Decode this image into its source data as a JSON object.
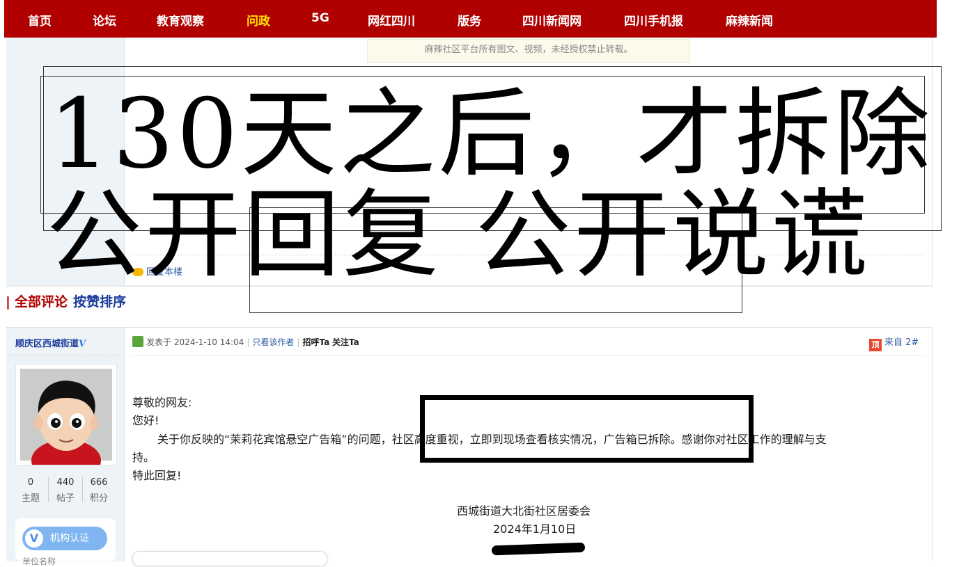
{
  "nav": {
    "items": [
      {
        "label": "首页"
      },
      {
        "label": "论坛"
      },
      {
        "label": "教育观察"
      },
      {
        "label": "问政"
      },
      {
        "label": "5G"
      },
      {
        "label": "网红四川"
      },
      {
        "label": "版务"
      },
      {
        "label": "四川新闻网"
      },
      {
        "label": "四川手机报"
      },
      {
        "label": "麻辣新闻"
      }
    ],
    "active": "问政"
  },
  "notice": "麻辣社区平台所有图文、视频，未经授权禁止转载。",
  "overlay": {
    "line1": "130天之后，才拆除",
    "line2": "公开回复 公开说谎"
  },
  "reply_link": "回复本楼",
  "comments": {
    "all_label": "全部评论",
    "sort_label": "按赞排序"
  },
  "post": {
    "username": "顺庆区西城街道",
    "verified_mark": "V",
    "stats": [
      {
        "value": "0",
        "label": "主题"
      },
      {
        "value": "440",
        "label": "帖子"
      },
      {
        "value": "666",
        "label": "积分"
      }
    ],
    "verify_label": "机构认证",
    "org_label": "单位名称",
    "meta": {
      "posted": "发表于 2024-1-10 14:04",
      "only_author": "只看该作者",
      "greet": "招呼Ta",
      "follow": "关注Ta"
    },
    "floor_icon": "顶",
    "floor": "来自 2#",
    "body": {
      "greeting": "尊敬的网友:",
      "hello": "您好!",
      "para_a": "关于你反映的“茉莉花宾馆悬空广告箱”的问题，社区高度重视，立即到现场查看核实情况，广告箱已拆除。感谢你对社区工作的理解与支",
      "para_b": "持。",
      "closing": "特此回复!"
    },
    "signature_org": "西城街道大北街社区居委会",
    "signature_date": "2024年1月10日"
  }
}
